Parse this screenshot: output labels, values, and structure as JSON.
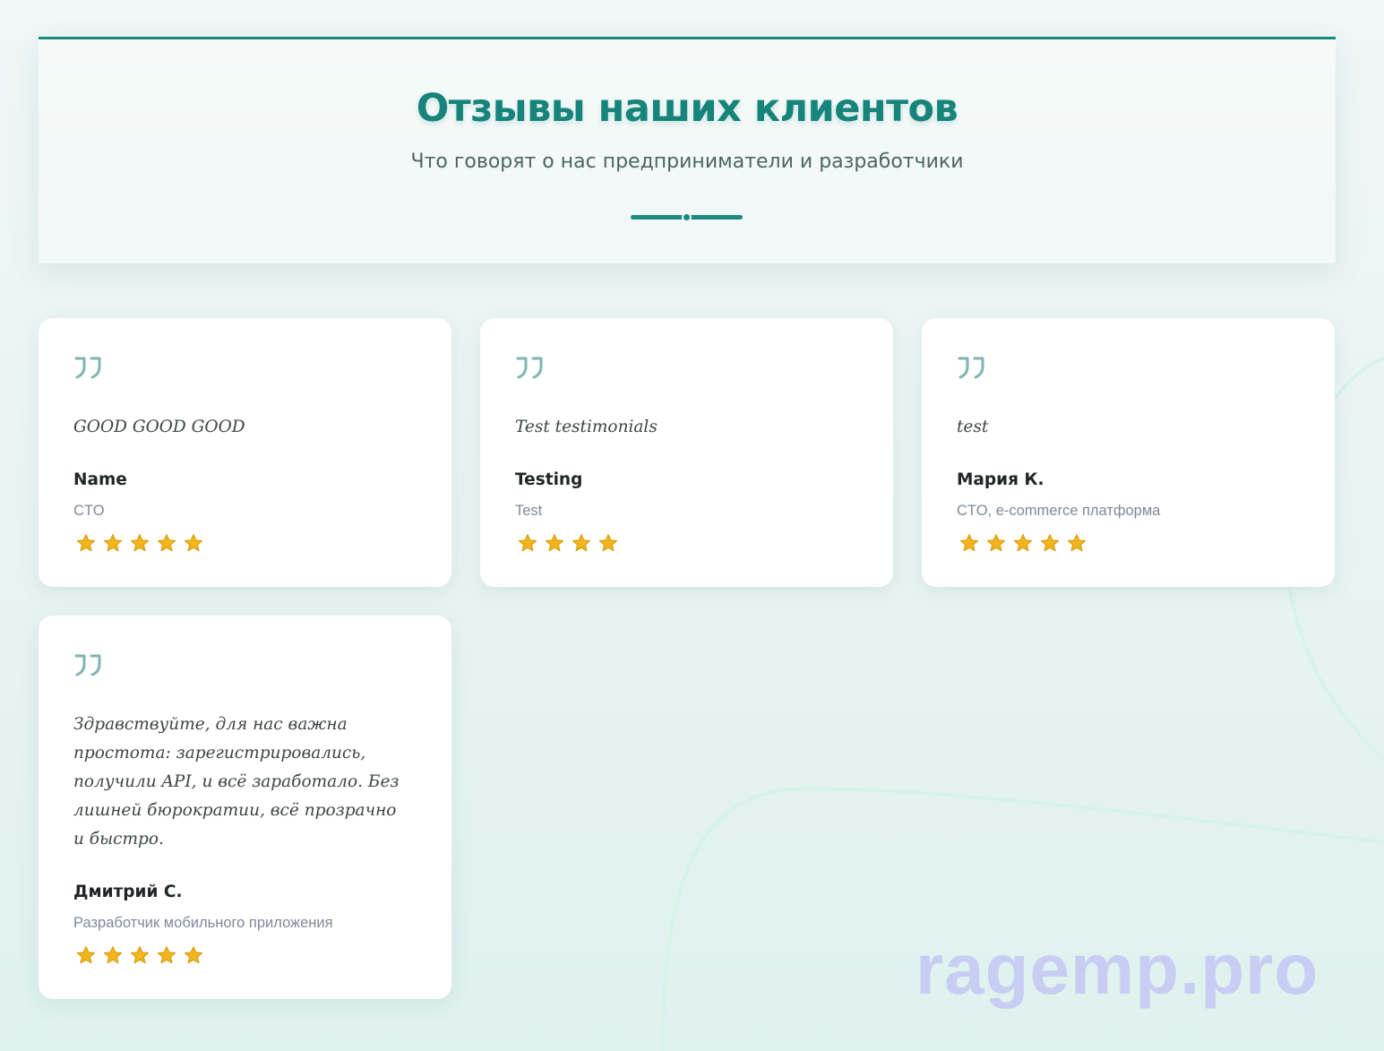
{
  "header": {
    "title": "Отзывы наших клиентов",
    "subtitle": "Что говорят о нас предприниматели и разработчики"
  },
  "testimonials": [
    {
      "text": "GOOD GOOD GOOD",
      "author": "Name",
      "role": "CTO",
      "rating": 5
    },
    {
      "text": "Test testimonials",
      "author": "Testing",
      "role": "Test",
      "rating": 4
    },
    {
      "text": "test",
      "author": "Мария К.",
      "role": "CTO, e-commerce платформа",
      "rating": 5
    },
    {
      "text": "Здравствуйте, для нас важна простота: зарегистрировались, получили API, и всё заработало. Без лишней бюрократии, всё прозрачно и быстро.",
      "author": "Дмитрий С.",
      "role": "Разработчик мобильного приложения",
      "rating": 5
    }
  ],
  "watermark": "ragemp.pro",
  "colors": {
    "accent": "#1a8a80",
    "title": "#16847a",
    "star": "#f2b61c",
    "quote_icon": "#7fb5b2"
  }
}
